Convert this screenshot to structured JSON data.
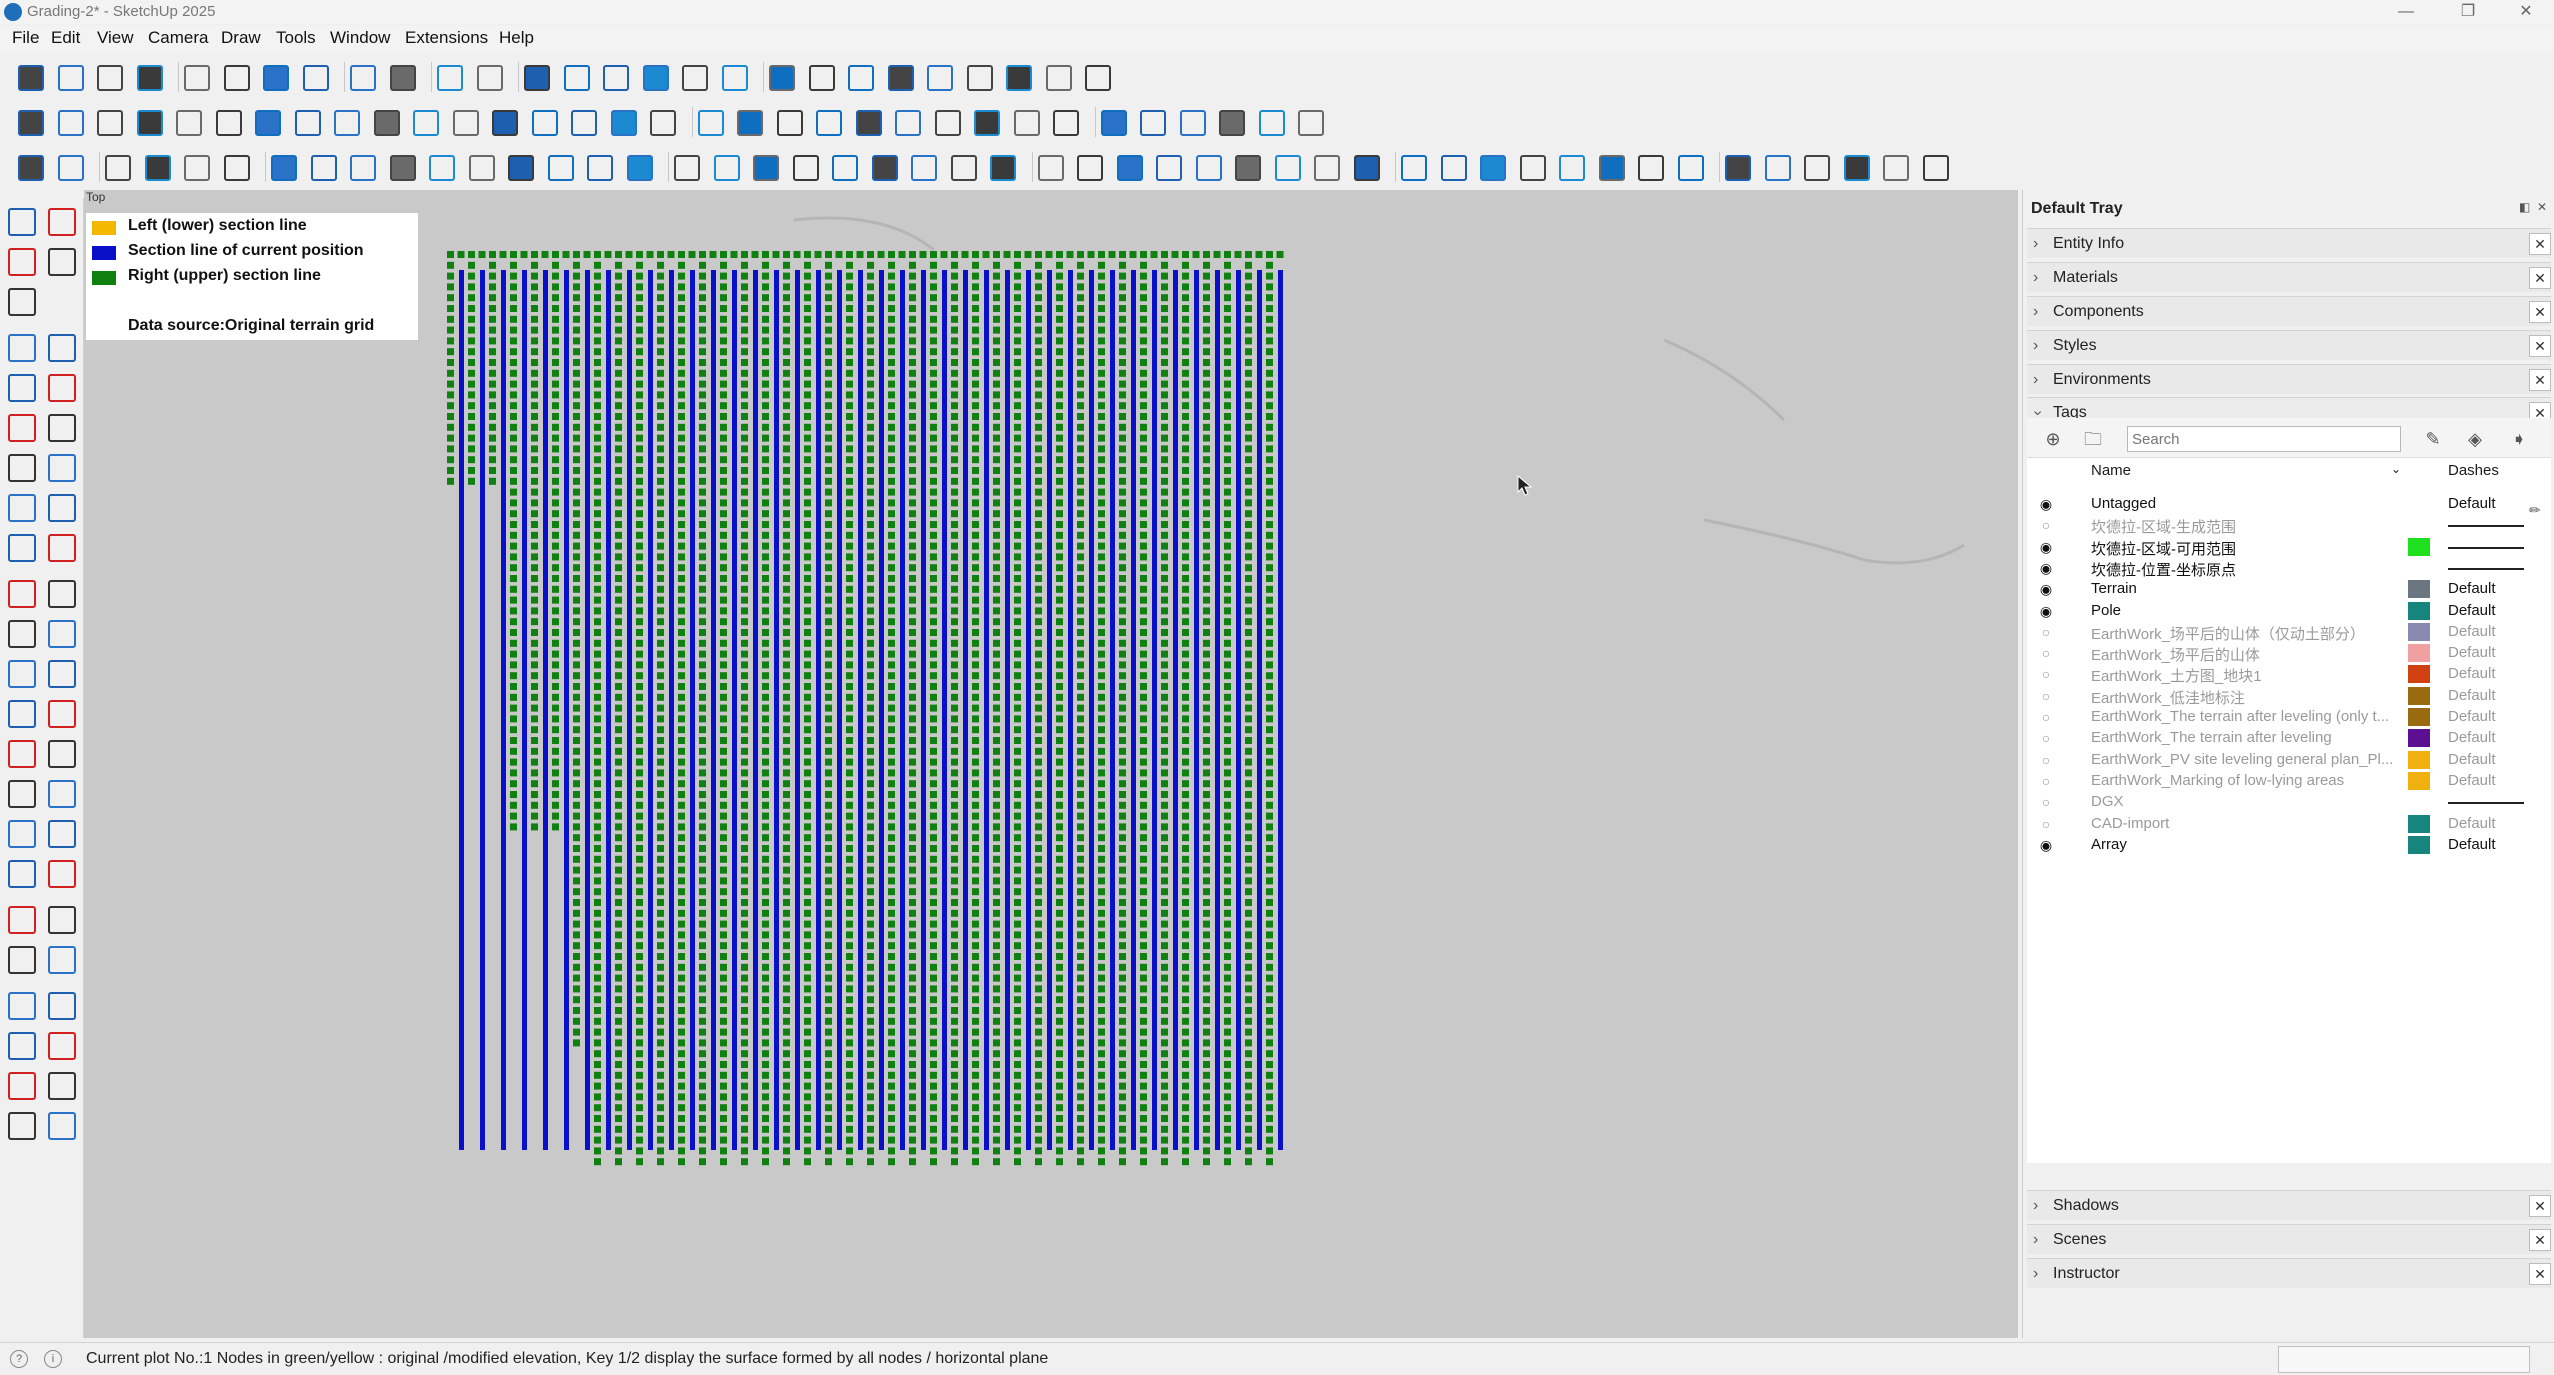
{
  "window": {
    "title": "Grading-2* - SketchUp 2025"
  },
  "menu": [
    "File",
    "Edit",
    "View",
    "Camera",
    "Draw",
    "Tools",
    "Window",
    "Extensions",
    "Help"
  ],
  "viewport": {
    "view_label": "Top"
  },
  "legend": {
    "items": [
      {
        "label": "Left (lower) section line",
        "color": "#f5b800"
      },
      {
        "label": "Section line of current position",
        "color": "#0a10c8"
      },
      {
        "label": "Right (upper) section line",
        "color": "#108010"
      }
    ],
    "data_source": "Data source:Original terrain grid"
  },
  "tray": {
    "title": "Default Tray",
    "top_panels": [
      "Entity Info",
      "Materials",
      "Components",
      "Styles",
      "Environments",
      "Tags"
    ],
    "bottom_panels": [
      "Shadows",
      "Scenes",
      "Instructor"
    ],
    "tags": {
      "search_placeholder": "Search",
      "col_name": "Name",
      "col_dashes": "Dashes",
      "rows": [
        {
          "name": "Untagged",
          "visible": true,
          "color": "",
          "dashes": "Default"
        },
        {
          "name": "坎德拉-区域-生成范围",
          "visible": false,
          "color": "",
          "dashes": "line"
        },
        {
          "name": "坎德拉-区域-可用范围",
          "visible": true,
          "color": "#1ee01e",
          "dashes": "line"
        },
        {
          "name": "坎德拉-位置-坐标原点",
          "visible": true,
          "color": "",
          "dashes": "line"
        },
        {
          "name": "Terrain",
          "visible": true,
          "color": "#6b7680",
          "dashes": "Default"
        },
        {
          "name": "Pole",
          "visible": true,
          "color": "#17857d",
          "dashes": "Default"
        },
        {
          "name": "EarthWork_场平后的山体（仅动土部分）",
          "visible": false,
          "color": "#8a8ab0",
          "dashes": "Default"
        },
        {
          "name": "EarthWork_场平后的山体",
          "visible": false,
          "color": "#f0a0a0",
          "dashes": "Default"
        },
        {
          "name": "EarthWork_土方图_地块1",
          "visible": false,
          "color": "#d04010",
          "dashes": "Default"
        },
        {
          "name": "EarthWork_低洼地标注",
          "visible": false,
          "color": "#9a6a10",
          "dashes": "Default"
        },
        {
          "name": "EarthWork_The terrain after leveling (only t...",
          "visible": false,
          "color": "#9a6a10",
          "dashes": "Default"
        },
        {
          "name": "EarthWork_The terrain after leveling",
          "visible": false,
          "color": "#5a1090",
          "dashes": "Default"
        },
        {
          "name": "EarthWork_PV site leveling general plan_Pl...",
          "visible": false,
          "color": "#f0b010",
          "dashes": "Default"
        },
        {
          "name": "EarthWork_Marking of low-lying areas",
          "visible": false,
          "color": "#f0b010",
          "dashes": "Default"
        },
        {
          "name": "DGX",
          "visible": false,
          "color": "",
          "dashes": "line"
        },
        {
          "name": "CAD-import",
          "visible": false,
          "color": "#17857d",
          "dashes": "Default"
        },
        {
          "name": "Array",
          "visible": true,
          "color": "#17857d",
          "dashes": "Default"
        }
      ]
    }
  },
  "status": {
    "text": "Current plot No.:1 Nodes in green/yellow : original /modified elevation, Key 1/2 display the surface formed by all nodes / horizontal plane"
  }
}
